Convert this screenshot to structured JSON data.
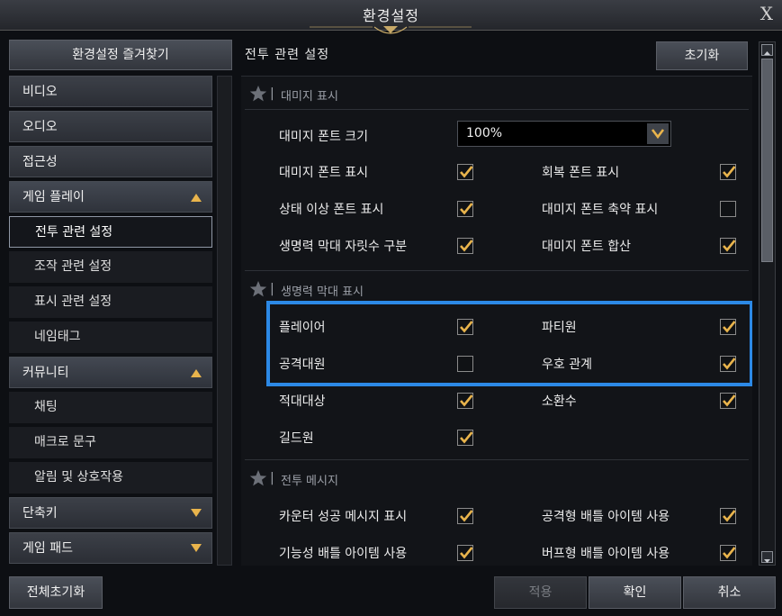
{
  "window": {
    "title": "환경설정",
    "close_label": "X"
  },
  "left": {
    "favorites_button": "환경설정 즐겨찾기",
    "nav": [
      {
        "label": "비디오",
        "kind": "cat"
      },
      {
        "label": "오디오",
        "kind": "cat"
      },
      {
        "label": "접근성",
        "kind": "cat"
      },
      {
        "label": "게임 플레이",
        "kind": "cat-open"
      },
      {
        "label": "전투 관련 설정",
        "kind": "sub-active"
      },
      {
        "label": "조작 관련 설정",
        "kind": "sub"
      },
      {
        "label": "표시 관련 설정",
        "kind": "sub"
      },
      {
        "label": "네임태그",
        "kind": "sub"
      },
      {
        "label": "커뮤니티",
        "kind": "cat-open"
      },
      {
        "label": "채팅",
        "kind": "sub"
      },
      {
        "label": "매크로 문구",
        "kind": "sub"
      },
      {
        "label": "알림 및 상호작용",
        "kind": "sub"
      },
      {
        "label": "단축키",
        "kind": "cat-closed"
      },
      {
        "label": "게임 패드",
        "kind": "cat-closed"
      }
    ]
  },
  "panel": {
    "title": "전투 관련 설정",
    "reset_label": "초기화",
    "sections": [
      {
        "title": "대미지 표시"
      },
      {
        "title": "생명력 막대 표시"
      },
      {
        "title": "전투 메시지"
      }
    ],
    "damage": {
      "font_size_label": "대미지 폰트 크기",
      "font_size_value": "100%",
      "rows": [
        {
          "left": "대미지 폰트 표시",
          "left_checked": true,
          "right": "회복 폰트 표시",
          "right_checked": true
        },
        {
          "left": "상태 이상 폰트 표시",
          "left_checked": true,
          "right": "대미지 폰트 축약 표시",
          "right_checked": false
        },
        {
          "left": "생명력 막대 자릿수 구분",
          "left_checked": true,
          "right": "대미지 폰트 합산",
          "right_checked": true
        }
      ]
    },
    "hpbar": {
      "rows": [
        {
          "left": "플레이어",
          "left_checked": true,
          "right": "파티원",
          "right_checked": true
        },
        {
          "left": "공격대원",
          "left_checked": false,
          "right": "우호 관계",
          "right_checked": true
        },
        {
          "left": "적대대상",
          "left_checked": true,
          "right": "소환수",
          "right_checked": true
        },
        {
          "left": "길드원",
          "left_checked": true
        }
      ]
    },
    "combat": {
      "rows": [
        {
          "left": "카운터 성공 메시지 표시",
          "left_checked": true,
          "right": "공격형 배틀 아이템 사용",
          "right_checked": true
        },
        {
          "left": "기능성 배틀 아이템 사용",
          "left_checked": true,
          "right": "버프형 배틀 아이템 사용",
          "right_checked": true
        }
      ]
    }
  },
  "footer": {
    "reset_all": "전체초기화",
    "apply": "적용",
    "confirm": "확인",
    "cancel": "취소"
  },
  "colors": {
    "highlight": "#2c89e6",
    "check": "#e9b44c"
  }
}
